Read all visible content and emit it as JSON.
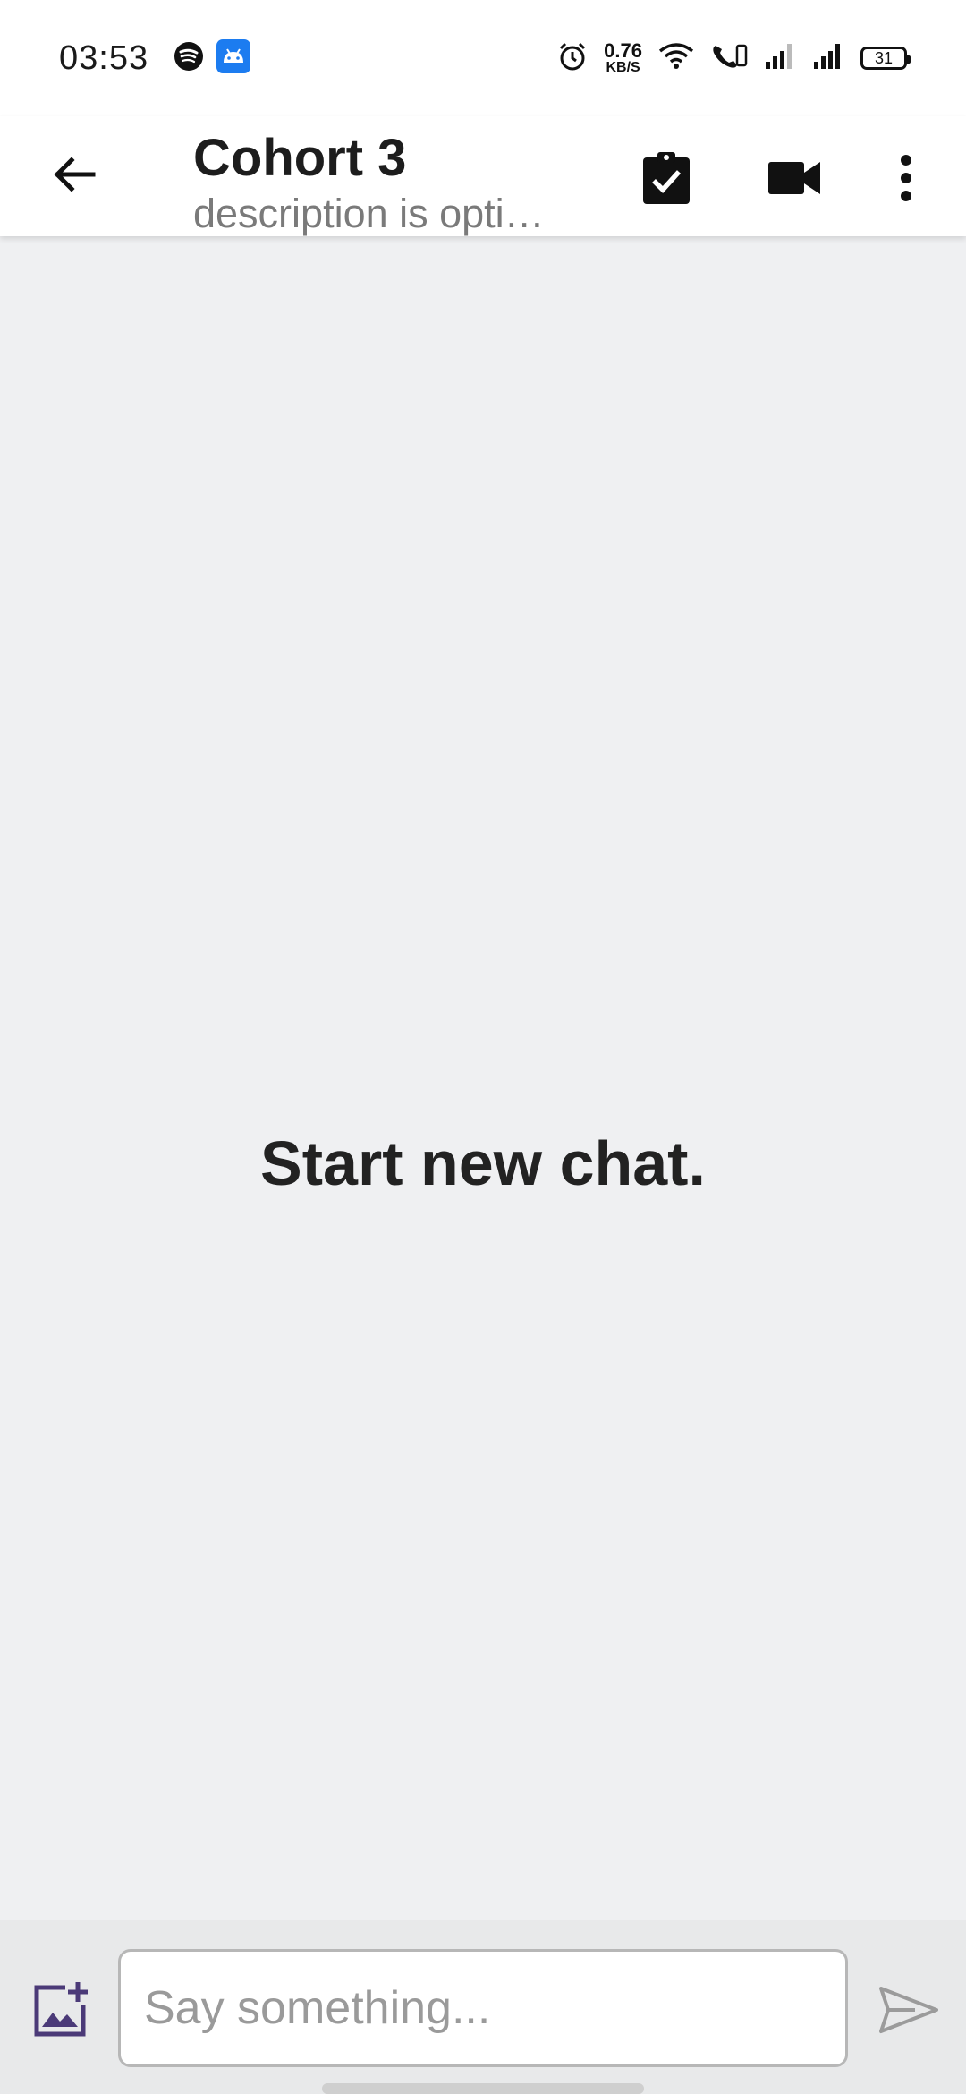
{
  "status_bar": {
    "time": "03:53",
    "net_speed_value": "0.76",
    "net_speed_unit": "KB/S",
    "battery": "31",
    "left_icons": [
      "spotify-icon",
      "android-icon"
    ],
    "right_icons": [
      "alarm-icon",
      "wifi-icon",
      "call-icon",
      "signal-icon",
      "signal-icon"
    ]
  },
  "header": {
    "title": "Cohort 3",
    "subtitle": "description is opti…",
    "back_icon": "arrow-left-icon",
    "actions": [
      "clipboard-check-icon",
      "video-camera-icon",
      "more-vertical-icon"
    ]
  },
  "main": {
    "empty_message": "Start new chat."
  },
  "composer": {
    "placeholder": "Say something...",
    "add_image_icon": "add-image-icon",
    "send_icon": "send-icon",
    "accent_color": "#4b3a78"
  }
}
